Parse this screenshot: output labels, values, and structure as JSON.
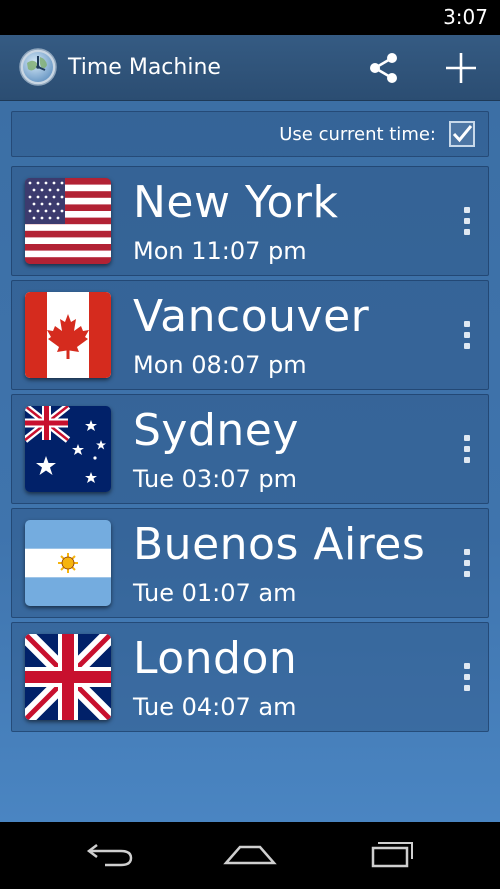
{
  "status_bar": {
    "time": "3:07"
  },
  "app_bar": {
    "title": "Time Machine",
    "icons": {
      "app": "clock-globe-icon",
      "share": "share-icon",
      "add": "plus-icon"
    }
  },
  "current_time": {
    "label": "Use current time:",
    "checked": true
  },
  "cities": [
    {
      "name": "New York",
      "time": "Mon 11:07 pm",
      "flag": "usa-flag-icon"
    },
    {
      "name": "Vancouver",
      "time": "Mon 08:07 pm",
      "flag": "canada-flag-icon"
    },
    {
      "name": "Sydney",
      "time": "Tue 03:07 pm",
      "flag": "australia-flag-icon"
    },
    {
      "name": "Buenos Aires",
      "time": "Tue 01:07 am",
      "flag": "argentina-flag-icon"
    },
    {
      "name": "London",
      "time": "Tue 04:07 am",
      "flag": "uk-flag-icon"
    }
  ],
  "nav_bar": {
    "icons": [
      "back-icon",
      "home-icon",
      "recents-icon"
    ]
  },
  "colors": {
    "app_bar": "#2f5479",
    "content_background": "#3f74ad",
    "card_background": "#34608f",
    "text": "#ffffff"
  }
}
